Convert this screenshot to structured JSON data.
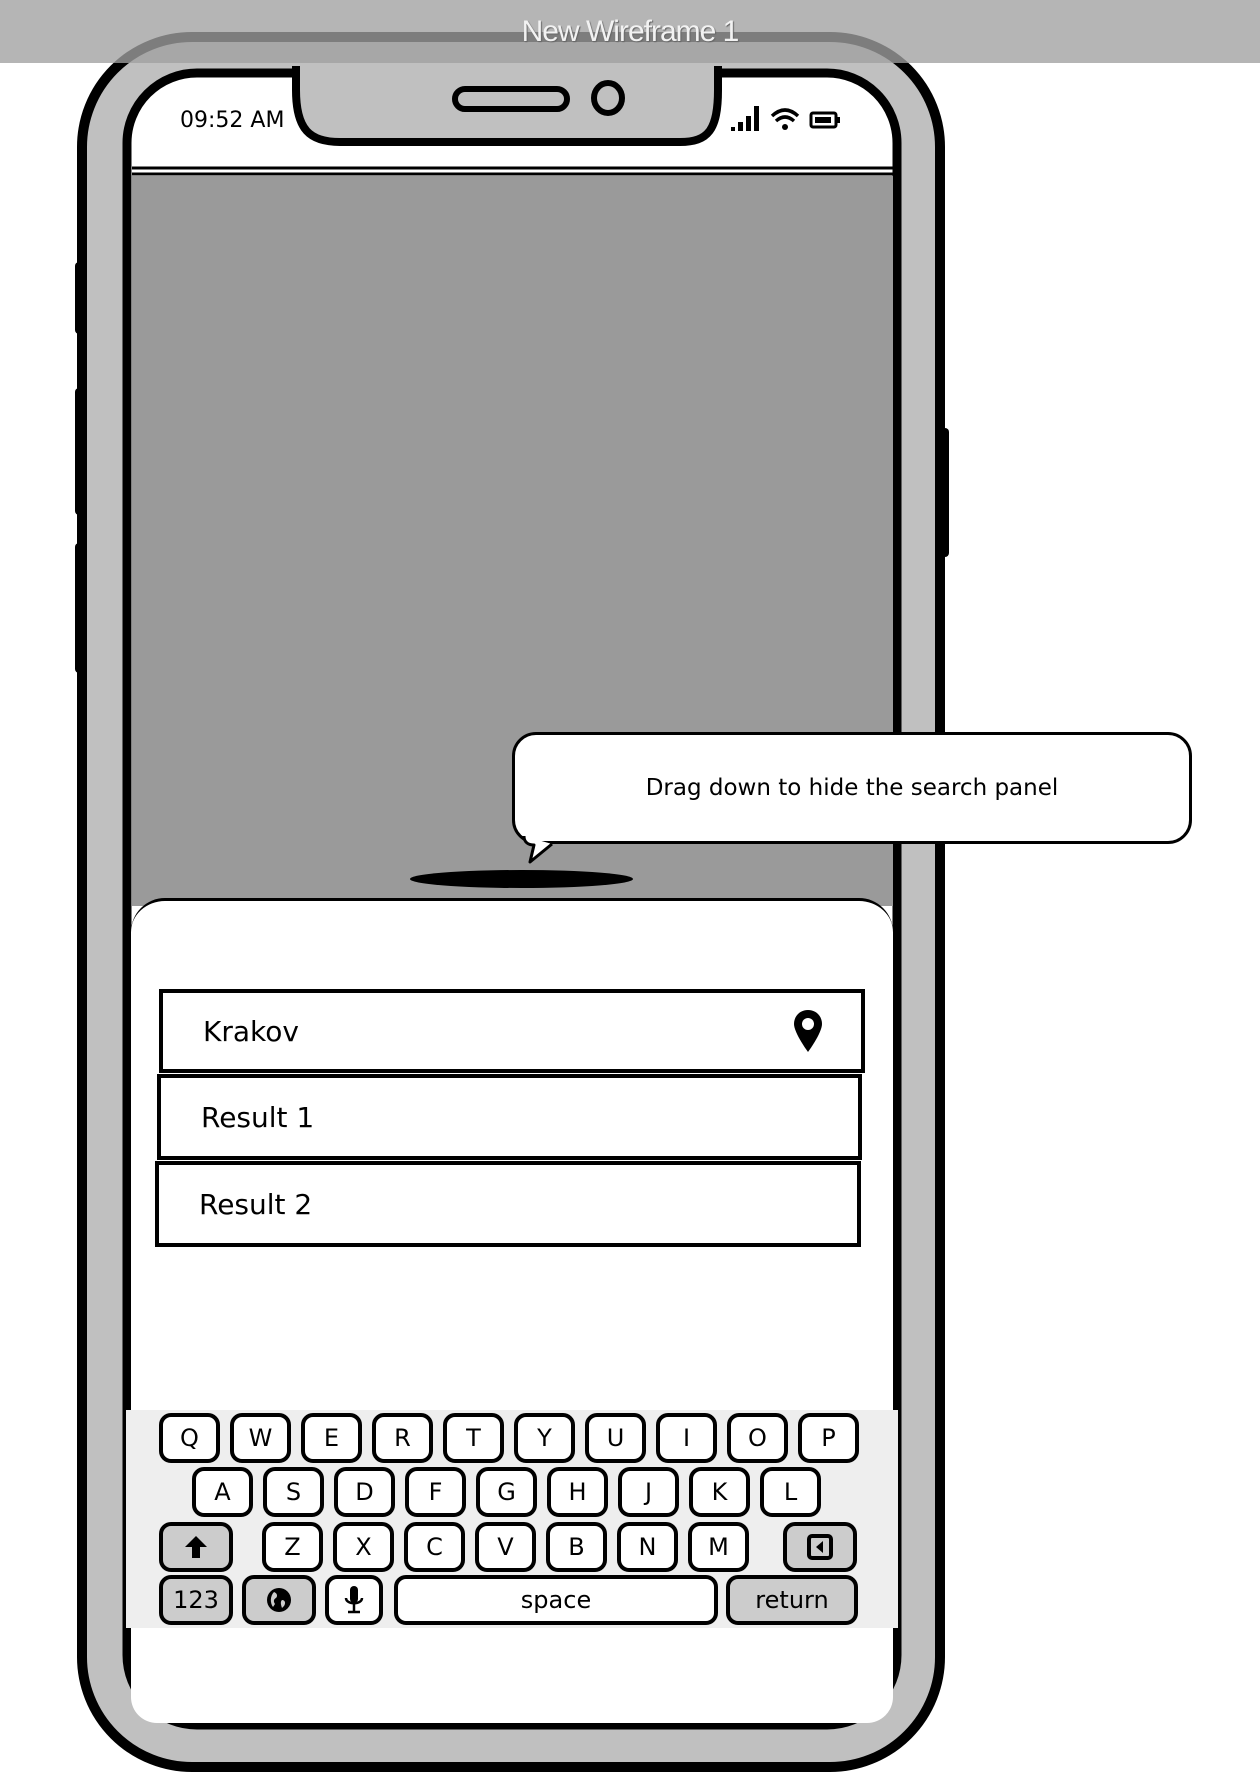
{
  "window": {
    "title": "New Wireframe 1"
  },
  "status_bar": {
    "time": "09:52 AM",
    "icons": [
      "signal-icon",
      "wifi-icon",
      "battery-icon"
    ]
  },
  "tooltip": {
    "text": "Drag down to hide the search panel"
  },
  "search_panel": {
    "search_input": {
      "value": "Krakov",
      "icon": "map-pin-icon"
    },
    "results": [
      {
        "label": "Result 1"
      },
      {
        "label": "Result 2"
      }
    ]
  },
  "keyboard": {
    "row1": [
      "Q",
      "W",
      "E",
      "R",
      "T",
      "Y",
      "U",
      "I",
      "O",
      "P"
    ],
    "row2": [
      "A",
      "S",
      "D",
      "F",
      "G",
      "H",
      "J",
      "K",
      "L"
    ],
    "row3": [
      "Z",
      "X",
      "C",
      "V",
      "B",
      "N",
      "M"
    ],
    "shift_icon": "arrow-up-icon",
    "backspace_icon": "backspace-icon",
    "numbers_label": "123",
    "globe_icon": "globe-icon",
    "mic_icon": "microphone-icon",
    "space_label": "space",
    "return_label": "return"
  },
  "colors": {
    "map_placeholder": "#9a9a9a",
    "bezel": "#c0c0c0",
    "keyboard_bg": "#eeeeee",
    "modifier_key": "#cccccc"
  }
}
